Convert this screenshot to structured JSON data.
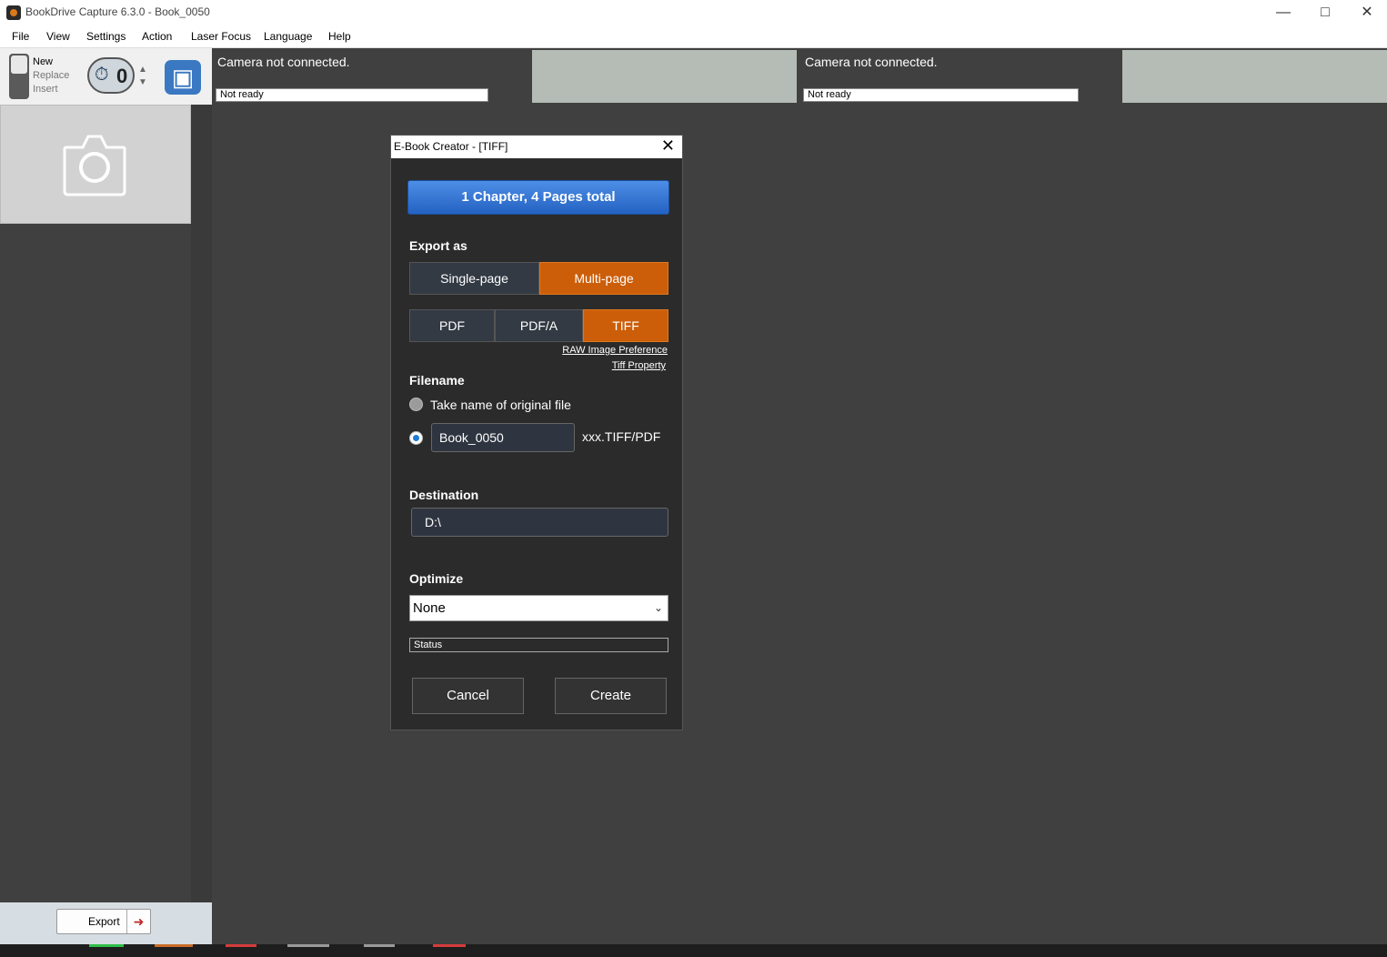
{
  "window": {
    "title": "BookDrive Capture 6.3.0 - Book_0050"
  },
  "menu": [
    "File",
    "View",
    "Settings",
    "Action",
    "Laser Focus",
    "Language",
    "Help"
  ],
  "toolbar": {
    "modes": [
      "New",
      "Replace",
      "Insert"
    ],
    "timer_value": "0"
  },
  "cameras": [
    {
      "message": "Camera not connected.",
      "status": "Not ready"
    },
    {
      "message": "Camera not connected.",
      "status": "Not ready"
    }
  ],
  "left": {
    "export_label": "Export"
  },
  "dialog": {
    "title": "E-Book Creator - [TIFF]",
    "summary": "1 Chapter, 4 Pages total",
    "export_as_label": "Export as",
    "page_modes": [
      "Single-page",
      "Multi-page"
    ],
    "active_page_mode": "Multi-page",
    "formats": [
      "PDF",
      "PDF/A",
      "TIFF"
    ],
    "active_format": "TIFF",
    "link_raw": "RAW Image Preference",
    "link_tiff": "Tiff Property",
    "filename_label": "Filename",
    "option_original": "Take name of original file",
    "filename_value": "Book_0050",
    "filename_suffix": "xxx.TIFF/PDF",
    "destination_label": "Destination",
    "destination_value": "D:\\",
    "optimize_label": "Optimize",
    "optimize_value": "None",
    "status": "Status",
    "cancel": "Cancel",
    "create": "Create"
  },
  "colors": {
    "accent_orange": "#cc5e0a",
    "summary_blue": "#2f72d6",
    "background": "#404040"
  }
}
